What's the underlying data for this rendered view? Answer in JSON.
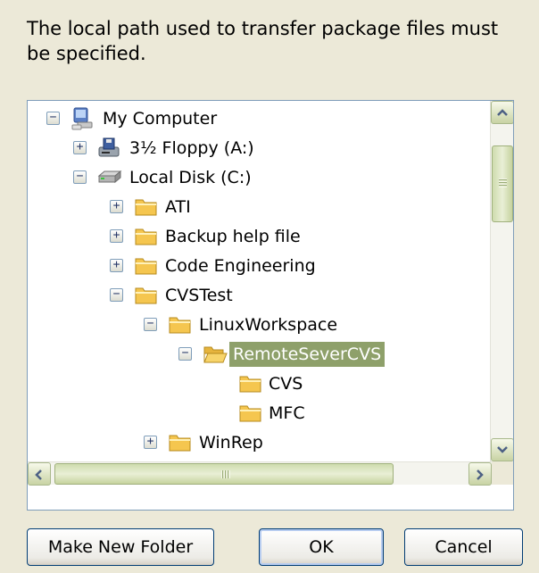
{
  "dialog": {
    "message": "The local path used to transfer package files must be specified."
  },
  "tree": {
    "nodes": [
      {
        "label": "My Computer",
        "expander": "minus",
        "icon": "computer-icon"
      },
      {
        "label": "3½ Floppy (A:)",
        "expander": "plus",
        "icon": "floppy-drive-icon"
      },
      {
        "label": "Local Disk (C:)",
        "expander": "minus",
        "icon": "hard-disk-icon"
      },
      {
        "label": "ATI",
        "expander": "plus",
        "icon": "folder-icon"
      },
      {
        "label": "Backup help file",
        "expander": "plus",
        "icon": "folder-icon"
      },
      {
        "label": "Code Engineering",
        "expander": "plus",
        "icon": "folder-icon"
      },
      {
        "label": "CVSTest",
        "expander": "minus",
        "icon": "folder-icon"
      },
      {
        "label": "LinuxWorkspace",
        "expander": "minus",
        "icon": "folder-icon"
      },
      {
        "label": "RemoteSeverCVS",
        "expander": "minus",
        "icon": "open-folder-icon",
        "selected": true
      },
      {
        "label": "CVS",
        "expander": "",
        "icon": "folder-icon"
      },
      {
        "label": "MFC",
        "expander": "",
        "icon": "folder-icon"
      },
      {
        "label": "WinRep",
        "expander": "plus",
        "icon": "folder-icon"
      }
    ]
  },
  "buttons": {
    "make_new_folder": "Make New Folder",
    "ok": "OK",
    "cancel": "Cancel"
  },
  "colors": {
    "selection": "#8ea06a",
    "window": "#ece9d8",
    "folder": "#f5c64f"
  }
}
